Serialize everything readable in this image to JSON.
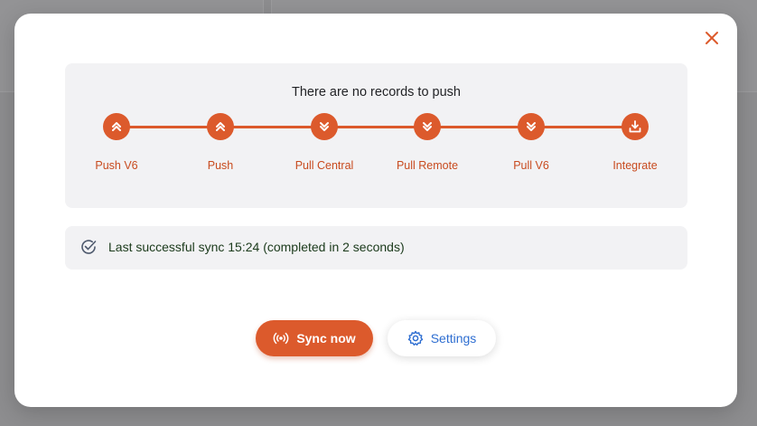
{
  "dialog": {
    "status_message": "There are no records to push",
    "steps": [
      {
        "label": "Push V6",
        "icon": "chevrons-up-icon"
      },
      {
        "label": "Push",
        "icon": "chevrons-up-icon"
      },
      {
        "label": "Pull Central",
        "icon": "chevrons-down-icon"
      },
      {
        "label": "Pull Remote",
        "icon": "chevrons-down-icon"
      },
      {
        "label": "Pull V6",
        "icon": "chevrons-down-icon"
      },
      {
        "label": "Integrate",
        "icon": "download-icon"
      }
    ],
    "last_sync": "Last successful sync 15:24 (completed in 2 seconds)",
    "buttons": {
      "sync_now": "Sync now",
      "settings": "Settings"
    },
    "colors": {
      "accent": "#dc5a2c",
      "label": "#c84b1f",
      "link": "#2e6ed1",
      "panel": "#f2f2f4"
    }
  }
}
